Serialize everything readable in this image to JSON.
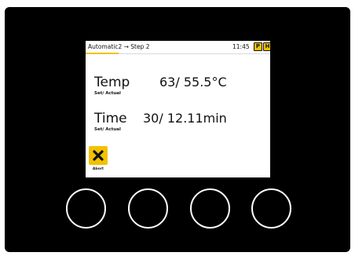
{
  "status_bar": {
    "step_path": "Automatic2 → Step 2",
    "time": "11:45",
    "mode_badges": [
      "P",
      "H"
    ],
    "step_progress_fraction": 0.18,
    "accent_color": "#f2c200"
  },
  "params": {
    "temp": {
      "label": "Temp",
      "sublabel": "Set/ Actual",
      "value": "63/ 55.5°C"
    },
    "time": {
      "label": "Time",
      "sublabel": "Set/ Actual",
      "value": "30/ 12.11min"
    }
  },
  "abort": {
    "label": "Abort",
    "icon": "x-icon"
  },
  "hardware_buttons": [
    {
      "id": 1
    },
    {
      "id": 2
    },
    {
      "id": 3
    },
    {
      "id": 4
    }
  ]
}
